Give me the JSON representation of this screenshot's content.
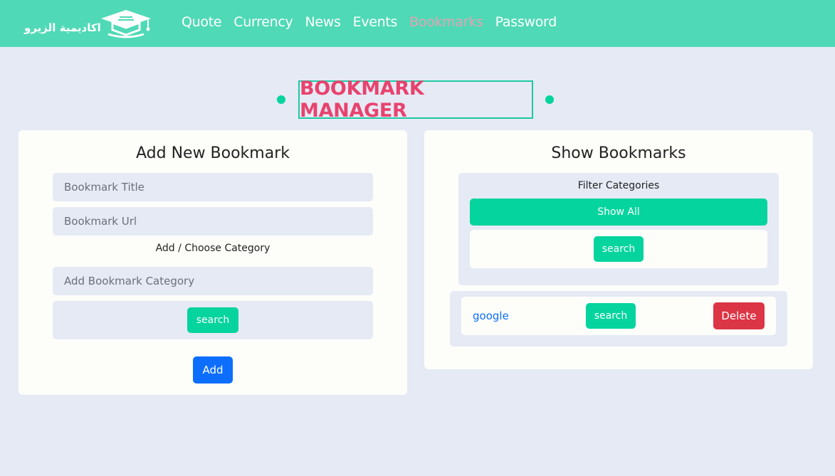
{
  "brand": {
    "logo_text": "اكاديمية الزيرو",
    "icon": "graduation-cap-book-icon"
  },
  "nav": {
    "items": [
      {
        "label": "Quote"
      },
      {
        "label": "Currency"
      },
      {
        "label": "News"
      },
      {
        "label": "Events"
      },
      {
        "label": "Bookmarks",
        "active": true
      },
      {
        "label": "Password"
      }
    ]
  },
  "page": {
    "title": "BOOKMARK MANAGER"
  },
  "add_card": {
    "title": "Add New Bookmark",
    "title_placeholder": "Bookmark Title",
    "url_placeholder": "Bookmark Url",
    "category_label": "Add / Choose Category",
    "category_placeholder": "Add Bookmark Category",
    "category_button": "search",
    "add_button": "Add"
  },
  "show_card": {
    "title": "Show Bookmarks",
    "filter_label": "Filter Categories",
    "show_all_button": "Show All",
    "categories": [
      {
        "label": "search"
      }
    ],
    "bookmarks": [
      {
        "name": "google",
        "category": "search",
        "delete_label": "Delete"
      }
    ]
  },
  "colors": {
    "navbar": "#50d9b6",
    "accent_green": "#05d49e",
    "title_pink": "#e8436e",
    "primary_blue": "#0d6efd",
    "danger_red": "#dc3545",
    "background": "#e6eaf5",
    "active_nav": "#e3a3b4"
  }
}
